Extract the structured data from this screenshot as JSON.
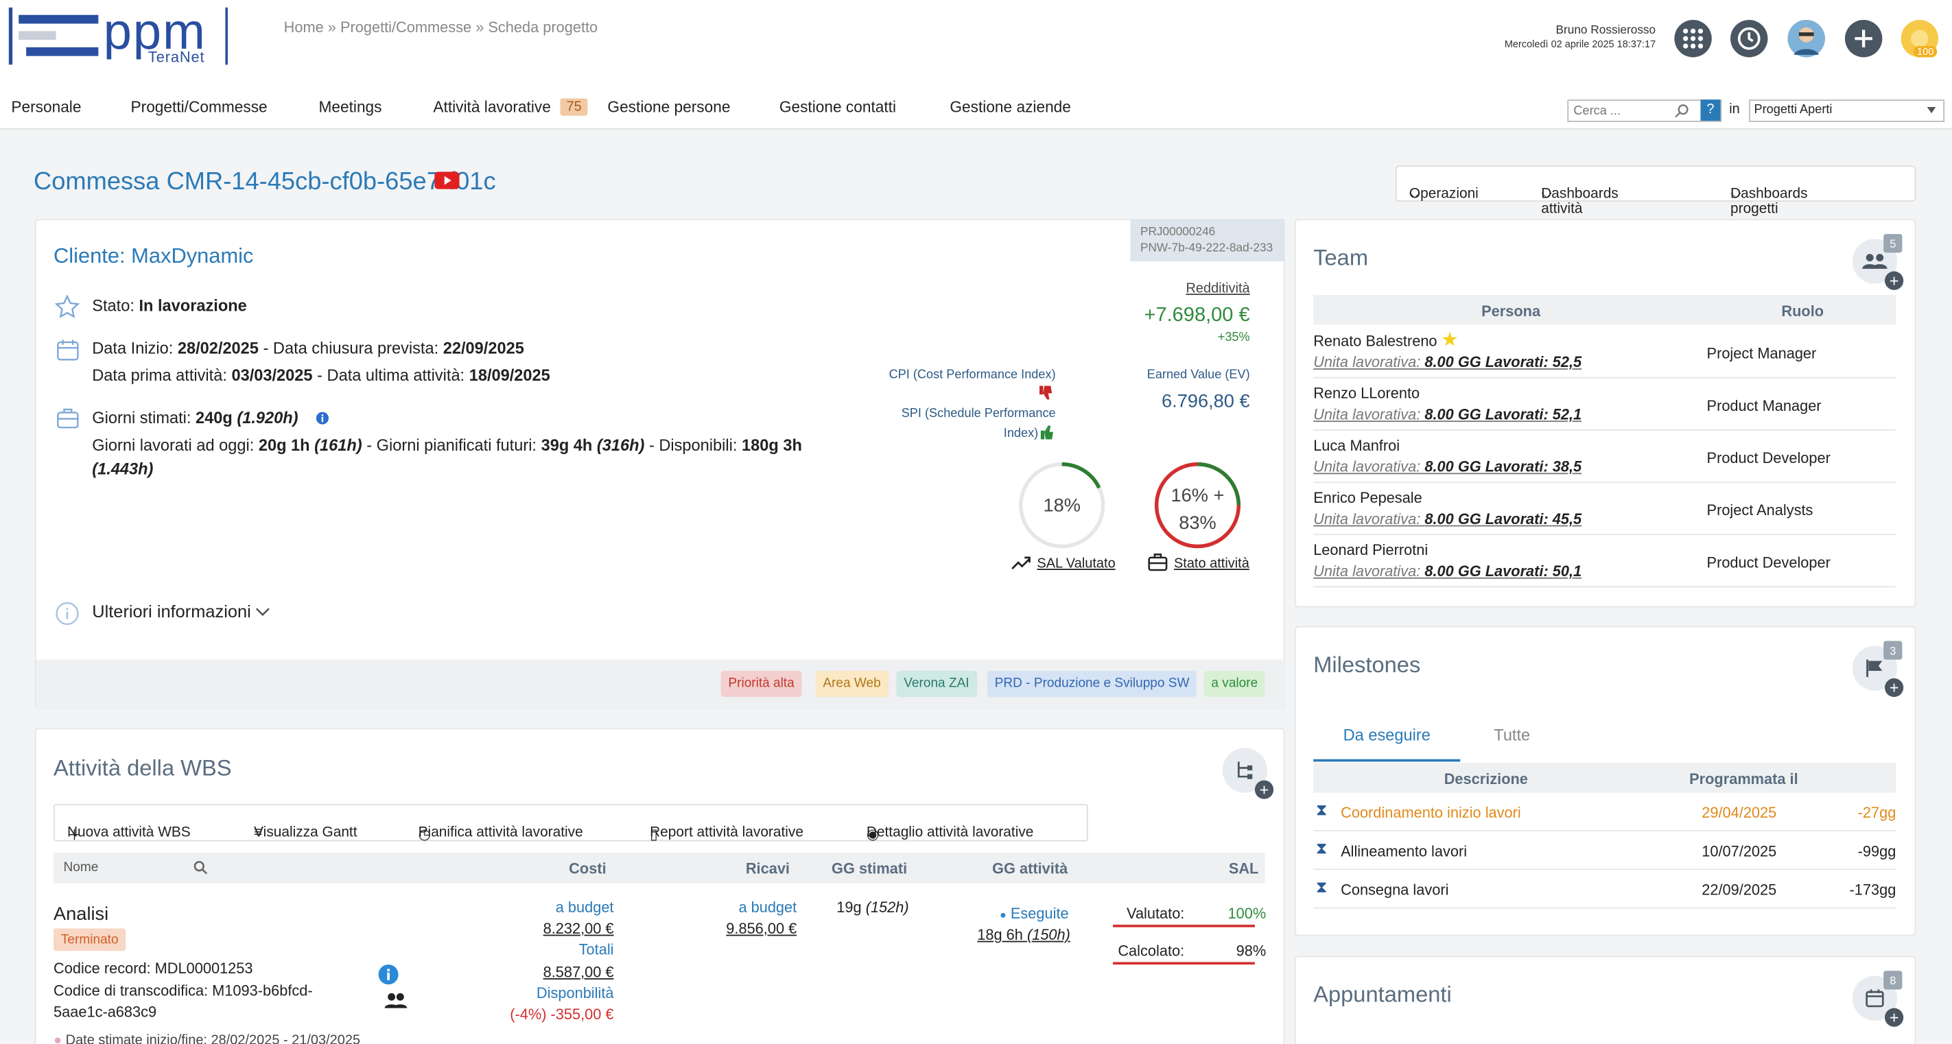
{
  "header": {
    "logo_text": "ppm",
    "logo_sub": "TeraNet",
    "breadcrumb": "Home » Progetti/Commesse » Scheda progetto",
    "user_name": "Bruno Rossierosso",
    "datetime": "Mercoledì 02 aprile 2025 18:37:17",
    "notif_count": "100"
  },
  "nav": {
    "items": [
      "Personale",
      "Progetti/Commesse",
      "Meetings",
      "Attività lavorative",
      "Gestione persone",
      "Gestione contatti",
      "Gestione aziende"
    ],
    "badge": "75",
    "search_placeholder": "Cerca ...",
    "help": "?",
    "in_label": "in",
    "scope": "Progetti Aperti"
  },
  "page": {
    "title": "Commessa CMR-14-45cb-cf0b-65e7-f01c",
    "ops": [
      "Operazioni",
      "Dashboards attività",
      "Dashboards progetti"
    ]
  },
  "project": {
    "client": "Cliente: MaxDynamic",
    "code1": "PRJ00000246",
    "code2": "PNW-7b-49-222-8ad-233",
    "stato_label": "Stato:",
    "stato": "In lavorazione",
    "data_inizio_label": "Data Inizio:",
    "data_inizio": "28/02/2025",
    "data_chiusura_label": "- Data chiusura prevista:",
    "data_chiusura": "22/09/2025",
    "prima_att_label": "Data prima attività:",
    "prima_att": "03/03/2025",
    "ultima_att_label": "- Data ultima attività:",
    "ultima_att": "18/09/2025",
    "gg_stimati_label": "Giorni stimati:",
    "gg_stimati": "240g",
    "gg_stimati_h": "(1.920h)",
    "gg_lav_label": "Giorni lavorati ad oggi:",
    "gg_lav": "20g 1h",
    "gg_lav_h": "(161h)",
    "gg_pian_label": "- Giorni pianificati futuri:",
    "gg_pian": "39g 4h",
    "gg_pian_h": "(316h)",
    "disp_label": "- Disponibili:",
    "disp": "180g 3h",
    "disp_h": "(1.443h)",
    "ulteriori": "Ulteriori informazioni",
    "redditivita_label": "Redditività",
    "redditivita": "+7.698,00 €",
    "redditivita_pct": "+35%",
    "cpi": "CPI (Cost Performance Index)",
    "spi1": "SPI (Schedule Performance",
    "spi2": "Index)",
    "ev_label": "Earned Value (EV)",
    "ev": "6.796,80 €",
    "sal_pct": "18%",
    "sal_fraction": 0.18,
    "stato_pct1": "16% +",
    "stato_pct2": "83%",
    "sal_label": "SAL Valutato",
    "stato_att_label": "Stato attività",
    "tags": [
      "Priorità alta",
      "Area Web",
      "Verona ZAI",
      "PRD - Produzione e Sviluppo SW",
      "a valore"
    ]
  },
  "team": {
    "title": "Team",
    "count": "5",
    "headers": [
      "Persona",
      "Ruolo"
    ],
    "ul_label": "Unita lavorativa:",
    "gg_label": "GG Lavorati:",
    "members": [
      {
        "name": "Renato Balestreno",
        "ul": "8.00",
        "gg": "52,5",
        "role": "Project Manager"
      },
      {
        "name": "Renzo LLorento",
        "ul": "8.00",
        "gg": "52,1",
        "role": "Product Manager"
      },
      {
        "name": "Luca Manfroi",
        "ul": "8.00",
        "gg": "38,5",
        "role": "Product Developer"
      },
      {
        "name": "Enrico Pepesale",
        "ul": "8.00",
        "gg": "45,5",
        "role": "Project Analysts"
      },
      {
        "name": "Leonard Pierrotni",
        "ul": "8.00",
        "gg": "50,1",
        "role": "Product Developer"
      }
    ]
  },
  "milestones": {
    "title": "Milestones",
    "count": "3",
    "tabs": [
      "Da eseguire",
      "Tutte"
    ],
    "headers": [
      "Descrizione",
      "Programmata il"
    ],
    "rows": [
      {
        "desc": "Coordinamento inizio lavori",
        "date": "29/04/2025",
        "delta": "-27gg"
      },
      {
        "desc": "Allineamento lavori",
        "date": "10/07/2025",
        "delta": "-99gg"
      },
      {
        "desc": "Consegna lavori",
        "date": "22/09/2025",
        "delta": "-173gg"
      }
    ]
  },
  "appuntamenti": {
    "title": "Appuntamenti",
    "count": "8"
  },
  "wbs": {
    "title": "Attività della WBS",
    "toolbar": [
      "Nuova attività WBS",
      "Visualizza Gantt",
      "Pianifica attività lavorative",
      "Report attività lavorative",
      "Dettaglio attività lavorative"
    ],
    "headers": [
      "Nome",
      "Costi",
      "Ricavi",
      "GG stimati",
      "GG attività",
      "SAL"
    ],
    "row": {
      "name": "Analisi",
      "status": "Terminato",
      "codice_record": "Codice record: MDL00001253",
      "transcodifica1": "Codice di transcodifica: M1093-b6bfcd-",
      "transcodifica2": "5aae1c-a683c9",
      "date_stimate": "Date stimate inizio/fine: 28/02/2025 - 21/03/2025",
      "costi_budget_label": "a budget",
      "costi_budget": "8.232,00 €",
      "totali_label": "Totali",
      "totali": "8.587,00 €",
      "disponibilita_label": "Disponbilità",
      "disponibilita": "(-4%) -355,00 €",
      "ricavi_label": "a budget",
      "ricavi": "9.856,00 €",
      "gg_stimati": "19g",
      "gg_stimati_h": "(152h)",
      "eseguite_label": "Eseguite",
      "gg_att": "18g 6h",
      "gg_att_h": "(150h)",
      "valutato_label": "Valutato:",
      "valutato": "100%",
      "calcolato_label": "Calcolato:",
      "calcolato": "98%"
    }
  },
  "colors": {
    "accent": "#2a7ab8",
    "green": "#2e8b3a",
    "red": "#d32f2f",
    "orange": "#e08a1a"
  }
}
